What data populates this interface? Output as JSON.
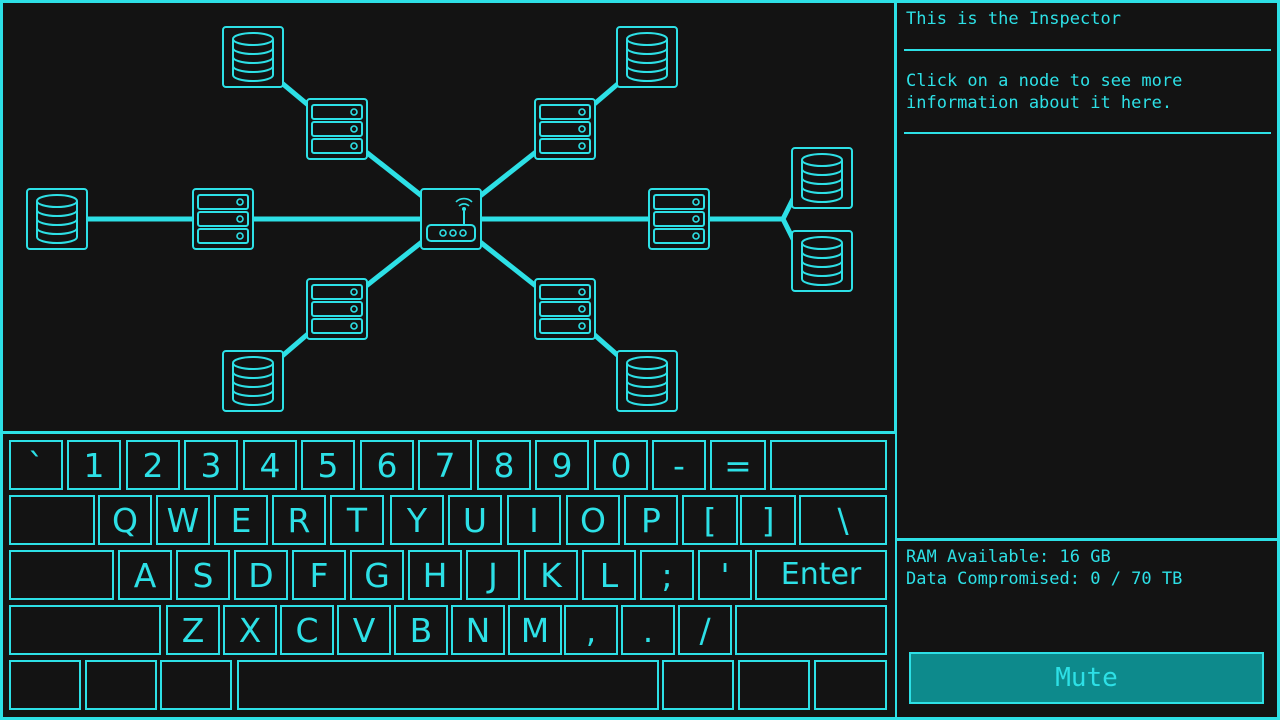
{
  "inspector": {
    "title": "This is the Inspector",
    "help": "Click on a node to see more information about it here."
  },
  "stats": {
    "ram": "RAM Available: 16 GB",
    "data": "Data Compromised: 0 / 70 TB"
  },
  "controls": {
    "mute_label": "Mute"
  },
  "network": {
    "hub": {
      "type": "router",
      "icon": "router-icon"
    },
    "branches": [
      {
        "server": "server-icon",
        "databases": [
          "database-icon"
        ]
      },
      {
        "server": "server-icon",
        "databases": [
          "database-icon"
        ]
      },
      {
        "server": "server-icon",
        "databases": [
          "database-icon",
          "database-icon"
        ]
      },
      {
        "server": "server-icon",
        "databases": [
          "database-icon"
        ]
      },
      {
        "server": "server-icon",
        "databases": [
          "database-icon"
        ]
      },
      {
        "server": "server-icon",
        "databases": [
          "database-icon"
        ]
      }
    ]
  },
  "keyboard": {
    "rows": [
      [
        "`",
        "1",
        "2",
        "3",
        "4",
        "5",
        "6",
        "7",
        "8",
        "9",
        "0",
        "-",
        "=",
        ""
      ],
      [
        "",
        "Q",
        "W",
        "E",
        "R",
        "T",
        "Y",
        "U",
        "I",
        "O",
        "P",
        "[",
        "]",
        "\\"
      ],
      [
        "",
        "A",
        "S",
        "D",
        "F",
        "G",
        "H",
        "J",
        "K",
        "L",
        ";",
        "'",
        "Enter"
      ],
      [
        "",
        "Z",
        "X",
        "C",
        "V",
        "B",
        "N",
        "M",
        ",",
        ".",
        "/",
        ""
      ],
      [
        "",
        "",
        "",
        "",
        "",
        "",
        "",
        ""
      ]
    ]
  },
  "colors": {
    "accent": "#2de0e6",
    "background": "#131313",
    "button_fill": "#0d8a8c"
  }
}
